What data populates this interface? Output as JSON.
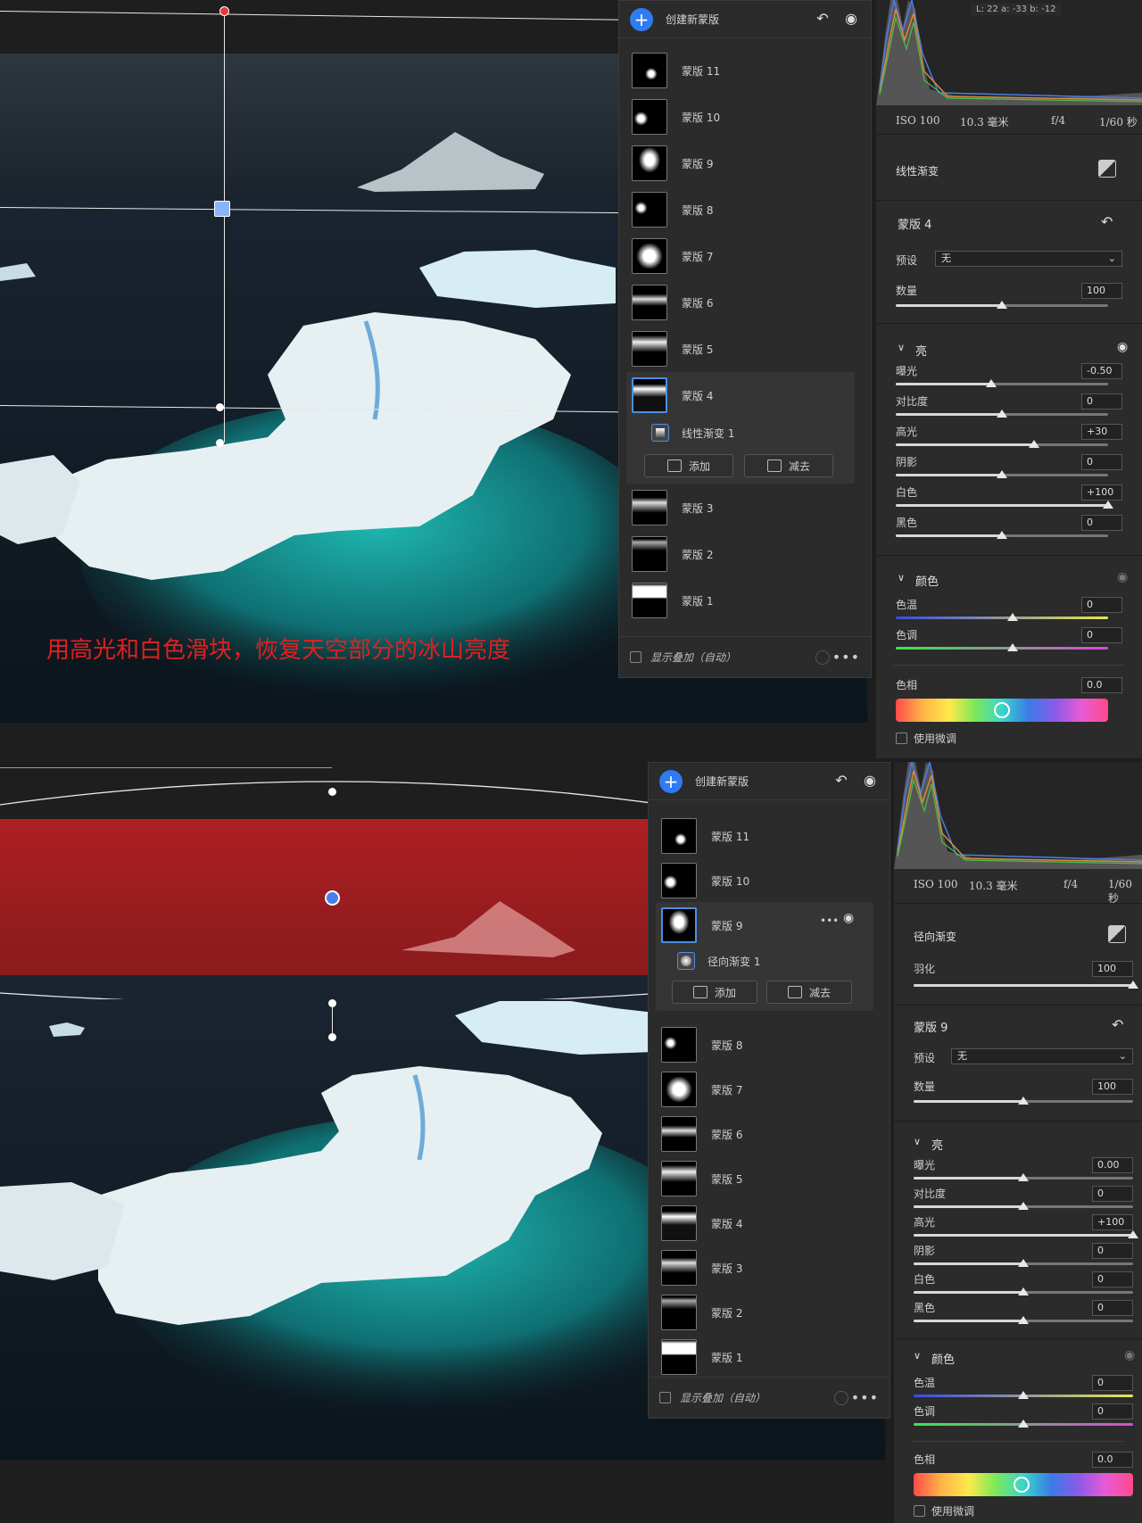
{
  "caption": "用高光和白色滑块，恢复天空部分的冰山亮度",
  "colors": {
    "accent": "#2f7bf2",
    "caption": "#e02020",
    "overlay": "#c41e1e"
  },
  "mask_panel_top": {
    "create_label": "创建新蒙版",
    "items": [
      "蒙版 11",
      "蒙版 10",
      "蒙版 9",
      "蒙版 8",
      "蒙版 7",
      "蒙版 6",
      "蒙版 5",
      "蒙版 4",
      "蒙版 3",
      "蒙版 2",
      "蒙版 1"
    ],
    "selected": "蒙版 4",
    "sub_item": "线性渐变 1",
    "add_label": "添加",
    "subtract_label": "减去",
    "overlay_label": "显示叠加（自动）"
  },
  "mask_panel_bottom": {
    "create_label": "创建新蒙版",
    "items": [
      "蒙版 11",
      "蒙版 10",
      "蒙版 9",
      "蒙版 8",
      "蒙版 7",
      "蒙版 6",
      "蒙版 5",
      "蒙版 4",
      "蒙版 3",
      "蒙版 2",
      "蒙版 1"
    ],
    "selected": "蒙版 9",
    "sub_item": "径向渐变 1",
    "add_label": "添加",
    "subtract_label": "减去",
    "overlay_label": "显示叠加（自动）"
  },
  "right_top": {
    "lab": "L: 22   a: -33   b: -12",
    "iso": "ISO 100",
    "focal": "10.3 毫米",
    "aperture": "f/4",
    "shutter": "1/60 秒",
    "tool": "线性渐变",
    "mask_name": "蒙版 4",
    "preset_label": "预设",
    "preset_value": "无",
    "amount_label": "数量",
    "amount_value": "100",
    "amount_pos": 0.5,
    "light_title": "亮",
    "light": [
      {
        "label": "曝光",
        "value": "-0.50",
        "pos": 0.45
      },
      {
        "label": "对比度",
        "value": "0",
        "pos": 0.5
      },
      {
        "label": "高光",
        "value": "+30",
        "pos": 0.65
      },
      {
        "label": "阴影",
        "value": "0",
        "pos": 0.5
      },
      {
        "label": "白色",
        "value": "+100",
        "pos": 1.0
      },
      {
        "label": "黑色",
        "value": "0",
        "pos": 0.5
      }
    ],
    "color_title": "颜色",
    "temp_label": "色温",
    "temp_value": "0",
    "tint_label": "色调",
    "tint_value": "0",
    "hue_label": "色相",
    "hue_value": "0.0",
    "fine_label": "使用微调"
  },
  "right_bottom": {
    "iso": "ISO 100",
    "focal": "10.3 毫米",
    "aperture": "f/4",
    "shutter": "1/60 秒",
    "tool": "径向渐变",
    "feather_label": "羽化",
    "feather_value": "100",
    "feather_pos": 1.0,
    "mask_name": "蒙版 9",
    "preset_label": "预设",
    "preset_value": "无",
    "amount_label": "数量",
    "amount_value": "100",
    "amount_pos": 0.5,
    "light_title": "亮",
    "light": [
      {
        "label": "曝光",
        "value": "0.00",
        "pos": 0.5
      },
      {
        "label": "对比度",
        "value": "0",
        "pos": 0.5
      },
      {
        "label": "高光",
        "value": "+100",
        "pos": 1.0
      },
      {
        "label": "阴影",
        "value": "0",
        "pos": 0.5
      },
      {
        "label": "白色",
        "value": "0",
        "pos": 0.5
      },
      {
        "label": "黑色",
        "value": "0",
        "pos": 0.5
      }
    ],
    "color_title": "颜色",
    "temp_label": "色温",
    "temp_value": "0",
    "tint_label": "色调",
    "tint_value": "0",
    "hue_label": "色相",
    "hue_value": "0.0",
    "fine_label": "使用微调"
  }
}
